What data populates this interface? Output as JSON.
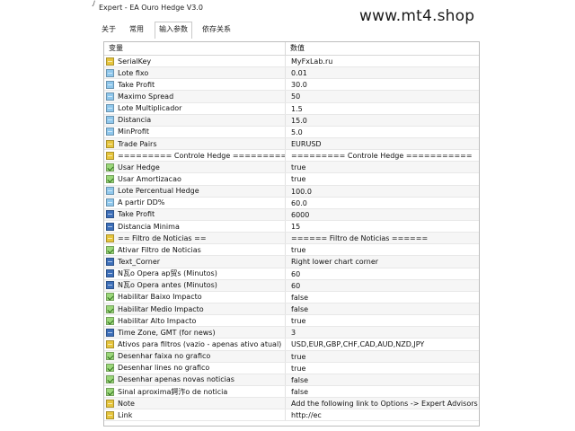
{
  "window": {
    "title": "Expert - EA Ouro Hedge V3.0"
  },
  "watermark": "www.mt4.shop",
  "tabs": [
    "关于",
    "常用",
    "输入参数",
    "依存关系"
  ],
  "active_tab": 2,
  "table": {
    "col_variable": "变量",
    "col_value": "数值",
    "rows": [
      {
        "name": "SerialKey",
        "value": "MyFxLab.ru",
        "icon": "string-param-icon"
      },
      {
        "name": "Lote fixo",
        "value": "0.01",
        "icon": "double-param-icon"
      },
      {
        "name": "Take Profit",
        "value": "30.0",
        "icon": "double-param-icon"
      },
      {
        "name": "Maximo Spread",
        "value": "50",
        "icon": "double-param-icon"
      },
      {
        "name": "Lote Multiplicador",
        "value": "1.5",
        "icon": "double-param-icon"
      },
      {
        "name": "Distancia",
        "value": "15.0",
        "icon": "double-param-icon"
      },
      {
        "name": "MinProfit",
        "value": "5.0",
        "icon": "double-param-icon"
      },
      {
        "name": "Trade Pairs",
        "value": "EURUSD",
        "icon": "string-param-icon"
      },
      {
        "name": "========= Controle Hedge ===========",
        "value": "========= Controle Hedge ===========",
        "icon": "string-param-icon"
      },
      {
        "name": "Usar Hedge",
        "value": "true",
        "icon": "bool-param-icon"
      },
      {
        "name": "Usar Amortizacao",
        "value": "true",
        "icon": "bool-param-icon"
      },
      {
        "name": "Lote Percentual Hedge",
        "value": "100.0",
        "icon": "double-param-icon"
      },
      {
        "name": "A partir DD%",
        "value": "60.0",
        "icon": "double-param-icon"
      },
      {
        "name": "Take Profit",
        "value": "6000",
        "icon": "int-param-icon"
      },
      {
        "name": "Distancia Minima",
        "value": "15",
        "icon": "int-param-icon"
      },
      {
        "name": "== Filtro de Noticias ==",
        "value": "====== Filtro de Noticias ======",
        "icon": "string-param-icon"
      },
      {
        "name": "Ativar Filtro de Noticias",
        "value": "true",
        "icon": "bool-param-icon"
      },
      {
        "name": "Text_Corner",
        "value": "Right lower chart corner",
        "icon": "int-param-icon"
      },
      {
        "name": "N瓦o Opera ap贸s (Minutos)",
        "value": "60",
        "icon": "int-param-icon"
      },
      {
        "name": "N瓦o Opera antes (Minutos)",
        "value": "60",
        "icon": "int-param-icon"
      },
      {
        "name": "Habilitar Baixo Impacto",
        "value": "false",
        "icon": "bool-param-icon"
      },
      {
        "name": "Habilitar Medio Impacto",
        "value": "false",
        "icon": "bool-param-icon"
      },
      {
        "name": "Habilitar Alto Impacto",
        "value": "true",
        "icon": "bool-param-icon"
      },
      {
        "name": "Time Zone, GMT (for news)",
        "value": "3",
        "icon": "int-param-icon"
      },
      {
        "name": "Ativos para filtros (vazio - apenas ativo atual)",
        "value": "USD,EUR,GBP,CHF,CAD,AUD,NZD,JPY",
        "icon": "string-param-icon"
      },
      {
        "name": "Desenhar faixa no grafico",
        "value": "true",
        "icon": "bool-param-icon"
      },
      {
        "name": "Desenhar lines no grafico",
        "value": "true",
        "icon": "bool-param-icon"
      },
      {
        "name": "Desenhar apenas novas noticias",
        "value": "false",
        "icon": "bool-param-icon"
      },
      {
        "name": "Sinal aproxima鍔泎o de noticia",
        "value": "false",
        "icon": "bool-param-icon"
      },
      {
        "name": "Note",
        "value": "Add the following link to Options -> Expert Advisors",
        "icon": "string-param-icon"
      },
      {
        "name": "Link",
        "value": "http://ec",
        "icon": "string-param-icon"
      }
    ]
  }
}
